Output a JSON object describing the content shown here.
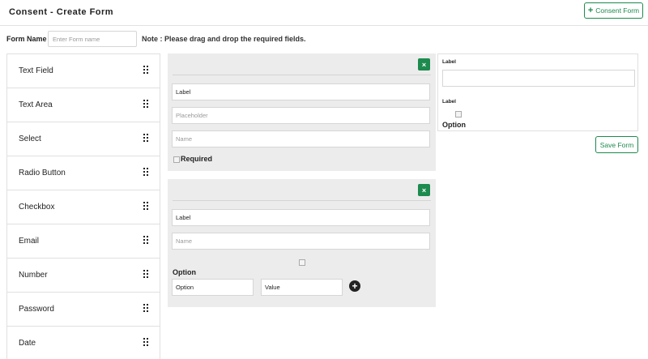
{
  "header": {
    "title": "Consent - Create Form",
    "consent_button_icon": "+",
    "consent_button_label": "Consent Form"
  },
  "form_name": {
    "label": "Form Name :",
    "placeholder": "Enter Form name",
    "value": ""
  },
  "note": "Note : Please drag and drop the required fields.",
  "field_types": [
    {
      "label": "Text Field"
    },
    {
      "label": "Text Area"
    },
    {
      "label": "Select"
    },
    {
      "label": "Radio Button"
    },
    {
      "label": "Checkbox"
    },
    {
      "label": "Email"
    },
    {
      "label": "Number"
    },
    {
      "label": "Password"
    },
    {
      "label": "Date"
    }
  ],
  "panel1": {
    "delete_icon": "×",
    "label_value": "Label",
    "placeholder_placeholder": "Placeholder",
    "name_placeholder": "Name",
    "required_label": "Required"
  },
  "panel2": {
    "delete_icon": "×",
    "label_value": "Label",
    "name_placeholder": "Name",
    "option_heading": "Option",
    "option_value": "Option",
    "value_value": "Value",
    "add_icon": "+"
  },
  "preview": {
    "label1": "Label",
    "label2": "Label",
    "option": "Option"
  },
  "save_button_label": "Save Form",
  "colors": {
    "accent_green": "#1d8a4e",
    "panel_bg": "#ececec"
  }
}
